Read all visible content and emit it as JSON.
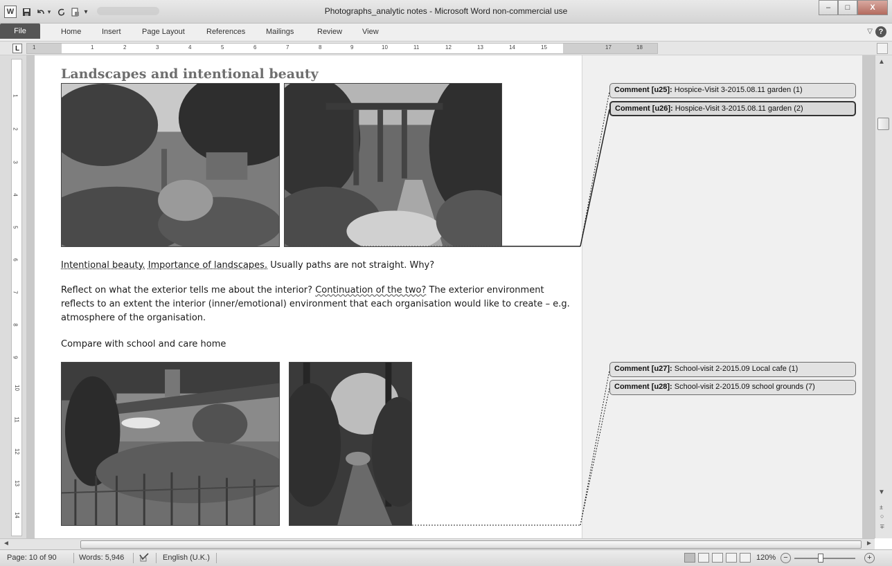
{
  "titlebar": {
    "title": "Photographs_analytic notes - Microsoft Word non-commercial use",
    "app_icon": "W",
    "icons": [
      "word-icon",
      "save-icon",
      "undo-icon",
      "redo-icon",
      "document-icon",
      "customize-icon"
    ],
    "controls": {
      "minimize": "–",
      "maximize": "□",
      "close": "X"
    }
  },
  "ribbon": {
    "tabs": [
      "File",
      "Home",
      "Insert",
      "Page Layout",
      "References",
      "Mailings",
      "Review",
      "View"
    ],
    "minimize_glyph": "▽",
    "help_glyph": "?"
  },
  "ruler": {
    "tab_selector": "L",
    "numbers": [
      "1",
      "1",
      "2",
      "3",
      "4",
      "5",
      "6",
      "7",
      "8",
      "9",
      "10",
      "11",
      "12",
      "13",
      "14",
      "15",
      "17",
      "18"
    ],
    "vertical_numbers": [
      "1",
      "2",
      "3",
      "4",
      "5",
      "6",
      "7",
      "8",
      "9",
      "10",
      "11",
      "12",
      "13",
      "14"
    ]
  },
  "document": {
    "heading": "Landscapes and intentional beauty",
    "para1": {
      "s1": "Intentional beauty.",
      "s2": "Importance of landscapes.",
      "s3": "Usually paths are not straight. Why?"
    },
    "para2": {
      "s1": "Reflect on what the exterior tells me about the interior?",
      "s2": "Continuation of the two?",
      "s3": "The exterior environment reflects to an extent the interior (inner/emotional) environment that each organisation would like to create – e.g. atmosphere of the organisation."
    },
    "para3": "Compare with school and care home"
  },
  "comments": [
    {
      "label": "Comment [u25]:",
      "text": "Hospice-Visit 3-2015.08.11 garden (1)"
    },
    {
      "label": "Comment [u26]:",
      "text": "Hospice-Visit 3-2015.08.11 garden (2)"
    },
    {
      "label": "Comment [u27]:",
      "text": "School-visit 2-2015.09 Local cafe (1)"
    },
    {
      "label": "Comment [u28]:",
      "text": "School-visit 2-2015.09 school grounds (7)"
    }
  ],
  "statusbar": {
    "page": "Page: 10 of 90",
    "words": "Words: 5,946",
    "language": "English (U.K.)",
    "zoom": "120%",
    "zoom_out": "−",
    "zoom_in": "+",
    "zoom_level_percent": 120
  },
  "scrollbars": {
    "up": "▲",
    "down": "▼",
    "left": "◄",
    "right": "►",
    "prev_page": "±",
    "browse_object": "○",
    "next_page": "∓"
  }
}
